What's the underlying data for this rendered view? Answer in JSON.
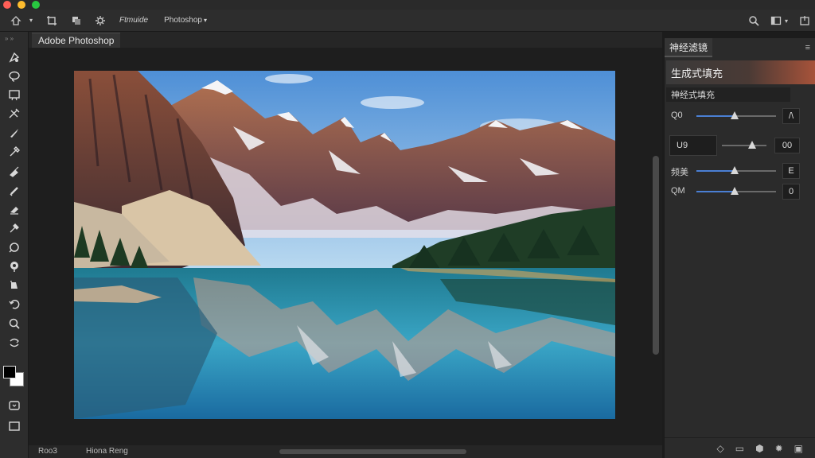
{
  "window": {
    "traffic_lights": [
      "#ff5f57",
      "#febc2e",
      "#28c840"
    ]
  },
  "menubar": {
    "home_icon": "home-icon",
    "item1": "Ftmuide",
    "item2": "Photoshop"
  },
  "document": {
    "tab_label": "Adobe Photoshop"
  },
  "statusbar": {
    "left": "Roo3",
    "mid": "Hiona Reng"
  },
  "panel": {
    "tab": "神经滤镜",
    "menu_icon": "≡",
    "generative_fill": "生成式填充",
    "subtitle": "神经式填充",
    "rows": [
      {
        "label": "Q0",
        "value": "/\\",
        "level": 0.48
      },
      {
        "label": "U9",
        "value": "00",
        "level": 0.68
      },
      {
        "label": "频美",
        "value": "E",
        "level": 0.48
      },
      {
        "label": "QM",
        "value": "0",
        "level": 0.48
      }
    ]
  },
  "colors": {
    "accent": "#4a7fd4",
    "gen_fill_gradient_end": "#a8533a"
  }
}
